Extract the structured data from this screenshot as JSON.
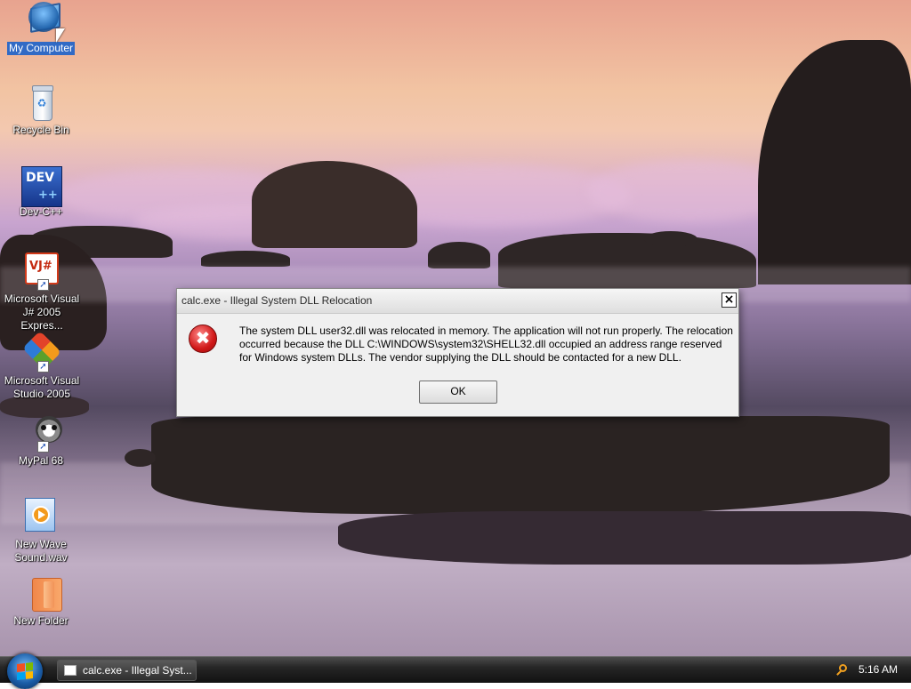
{
  "desktop": {
    "icons": [
      {
        "label": "My Computer",
        "icon": "my-computer-icon"
      },
      {
        "label": "Recycle Bin",
        "icon": "recycle-bin-icon"
      },
      {
        "label": "Dev-C++",
        "icon": "dev-cpp-icon",
        "badge": "DEV"
      },
      {
        "label": "Microsoft Visual J# 2005 Expres...",
        "icon": "visual-jsharp-icon",
        "badge": "VJ#"
      },
      {
        "label": "Microsoft Visual Studio 2005",
        "icon": "visual-studio-icon"
      },
      {
        "label": "MyPal 68",
        "icon": "mypal-icon"
      },
      {
        "label": "New Wave Sound.wav",
        "icon": "wave-sound-icon"
      },
      {
        "label": "New Folder",
        "icon": "folder-icon"
      }
    ]
  },
  "dialog": {
    "title": "calc.exe - Illegal System DLL Relocation",
    "close_glyph": "×",
    "error_glyph": "✖",
    "message": "The system DLL user32.dll was relocated in memory. The application will not run properly. The relocation occurred because the DLL C:\\WINDOWS\\system32\\SHELL32.dll occupied an address range reserved for Windows system DLLs. The vendor supplying the DLL should be contacted for a new DLL.",
    "ok_label": "OK"
  },
  "taskbar": {
    "task_label": "calc.exe - Illegal Syst...",
    "clock": "5:16 AM"
  }
}
